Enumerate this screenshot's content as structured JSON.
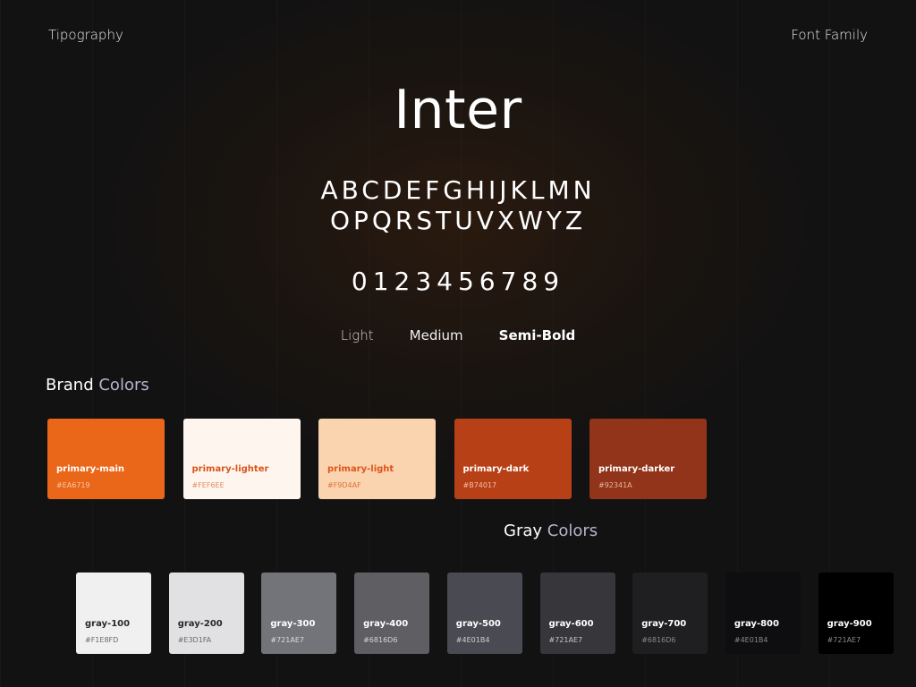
{
  "header": {
    "left_label": "Tipography",
    "right_label": "Font Family"
  },
  "typography": {
    "font_name": "Inter",
    "alphabet_line1": "ABCDEFGHIJKLMN",
    "alphabet_line2": "OPQRSTUVXWYZ",
    "digits": "0123456789",
    "weights": {
      "light": "Light",
      "medium": "Medium",
      "semibold": "Semi-Bold"
    }
  },
  "brand_colors": {
    "title_main": "Brand",
    "title_accent": "Colors",
    "swatches": [
      {
        "name": "primary-main",
        "hex": "#EA6719",
        "color": "#EA6719",
        "text_color": "#ffffff",
        "hex_color": "#f8c9a8"
      },
      {
        "name": "primary-lighter",
        "hex": "#FEF6EE",
        "color": "#FEF6EE",
        "text_color": "#d9541a",
        "hex_color": "#e38a5a"
      },
      {
        "name": "primary-light",
        "hex": "#F9D4AF",
        "color": "#F9D4AF",
        "text_color": "#e0541b",
        "hex_color": "#e0703a"
      },
      {
        "name": "primary-dark",
        "hex": "#B74017",
        "color": "#B74017",
        "text_color": "#ffffff",
        "hex_color": "#f2c0a4"
      },
      {
        "name": "primary-darker",
        "hex": "#92341A",
        "color": "#92341A",
        "text_color": "#ffffff",
        "hex_color": "#e7b6a0"
      }
    ]
  },
  "gray_colors": {
    "title_main": "Gray",
    "title_accent": "Colors",
    "swatches": [
      {
        "name": "gray-100",
        "hex": "#F1E8FD",
        "color": "#F0F0F0",
        "text_color": "#2a2a2a",
        "hex_color": "#6a6a6a"
      },
      {
        "name": "gray-200",
        "hex": "#E3D1FA",
        "color": "#E1E1E3",
        "text_color": "#2a2a2a",
        "hex_color": "#6a6a6a"
      },
      {
        "name": "gray-300",
        "hex": "#721AE7",
        "color": "#73737A",
        "text_color": "#ffffff",
        "hex_color": "#dcdcdc"
      },
      {
        "name": "gray-400",
        "hex": "#6816D6",
        "color": "#5E5E63",
        "text_color": "#ffffff",
        "hex_color": "#d6d6d6"
      },
      {
        "name": "gray-500",
        "hex": "#4E01B4",
        "color": "#4A4A52",
        "text_color": "#ffffff",
        "hex_color": "#cfcfcf"
      },
      {
        "name": "gray-600",
        "hex": "#721AE7",
        "color": "#36363B",
        "text_color": "#ffffff",
        "hex_color": "#c8c8c8"
      },
      {
        "name": "gray-700",
        "hex": "#6816D6",
        "color": "#1F1F22",
        "text_color": "#ffffff",
        "hex_color": "#8a8a8a"
      },
      {
        "name": "gray-800",
        "hex": "#4E01B4",
        "color": "#0E0E10",
        "text_color": "#ffffff",
        "hex_color": "#8a8a8a"
      },
      {
        "name": "gray-900",
        "hex": "#721AE7",
        "color": "#000000",
        "text_color": "#ffffff",
        "hex_color": "#8a8a8a"
      }
    ]
  }
}
